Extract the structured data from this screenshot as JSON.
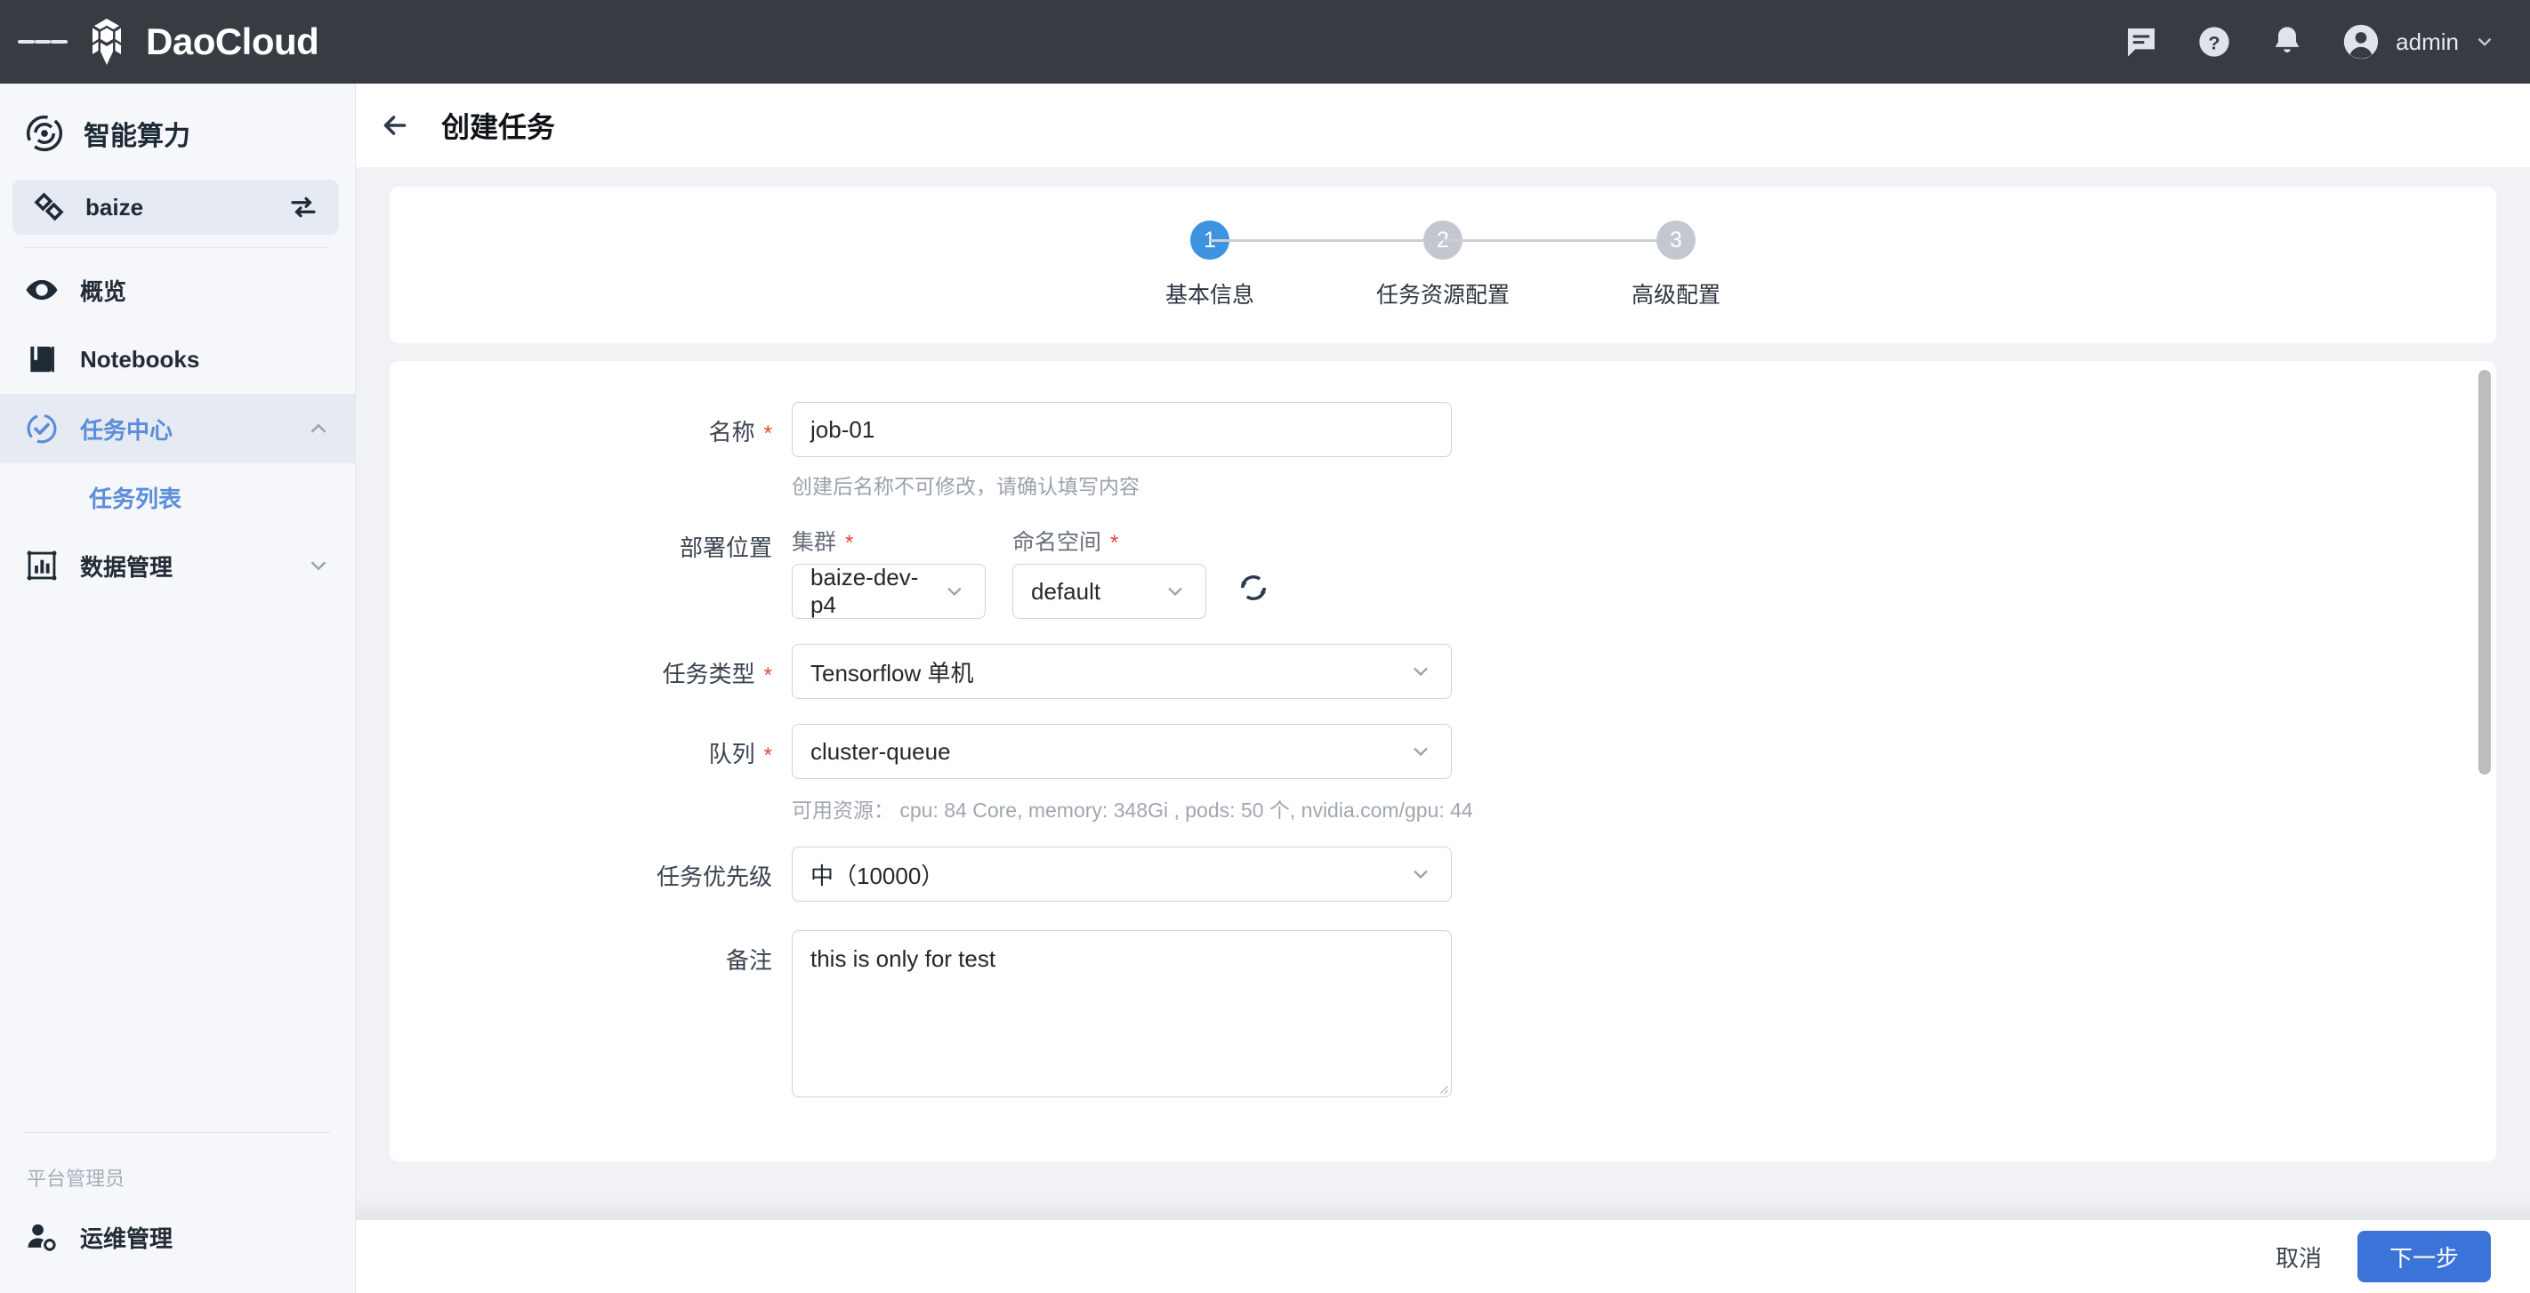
{
  "topbar": {
    "menu_icon": "hamburger-icon",
    "brand": "DaoCloud",
    "icons": [
      "chat-icon",
      "help-icon",
      "bell-icon"
    ],
    "user": "admin",
    "user_chevron": "chevron-down-icon"
  },
  "sidebar": {
    "product_title": "智能算力",
    "workspace": {
      "name": "baize",
      "switch_icon": "swap-icon"
    },
    "items": [
      {
        "label": "概览",
        "icon": "eye-icon",
        "active": false
      },
      {
        "label": "Notebooks",
        "icon": "book-icon",
        "active": false
      },
      {
        "label": "任务中心",
        "icon": "task-check-icon",
        "active": true,
        "chevron": "chevron-up-icon"
      },
      {
        "label": "数据管理",
        "icon": "chart-box-icon",
        "active": false,
        "chevron": "chevron-down-icon"
      }
    ],
    "sub_items": [
      {
        "label": "任务列表",
        "active": true
      }
    ],
    "group_label": "平台管理员",
    "admin_item": {
      "label": "运维管理",
      "icon": "user-gear-icon"
    }
  },
  "page": {
    "back_icon": "arrow-left-icon",
    "title": "创建任务"
  },
  "stepper": {
    "steps": [
      {
        "num": "1",
        "label": "基本信息",
        "active": true
      },
      {
        "num": "2",
        "label": "任务资源配置",
        "active": false
      },
      {
        "num": "3",
        "label": "高级配置",
        "active": false
      }
    ]
  },
  "form": {
    "name": {
      "label": "名称",
      "required": "*",
      "value": "job-01",
      "hint": "创建后名称不可修改，请确认填写内容"
    },
    "deploy": {
      "label": "部署位置",
      "cluster": {
        "label": "集群",
        "required": "*",
        "value": "baize-dev-p4",
        "chevron": "chevron-down-icon"
      },
      "namespace": {
        "label": "命名空间",
        "required": "*",
        "value": "default",
        "chevron": "chevron-down-icon"
      },
      "refresh_icon": "refresh-icon"
    },
    "job_type": {
      "label": "任务类型",
      "required": "*",
      "value": "Tensorflow 单机",
      "chevron": "chevron-down-icon"
    },
    "queue": {
      "label": "队列",
      "required": "*",
      "value": "cluster-queue",
      "chevron": "chevron-down-icon",
      "hint": "可用资源： cpu: 84 Core, memory: 348Gi , pods: 50 个, nvidia.com/gpu: 44"
    },
    "priority": {
      "label": "任务优先级",
      "value": "中（10000）",
      "chevron": "chevron-down-icon"
    },
    "remark": {
      "label": "备注",
      "value": "this is only for test"
    }
  },
  "footer": {
    "cancel": "取消",
    "next": "下一步"
  },
  "colors": {
    "topbar_bg": "#373c43",
    "sidebar_bg": "#f5f7fa",
    "content_bg": "#f0f2f5",
    "accent_blue": "#3b73d8",
    "step_active": "#3e93e0",
    "nav_active_text": "#5b8ddb",
    "required_red": "#e5452f"
  }
}
